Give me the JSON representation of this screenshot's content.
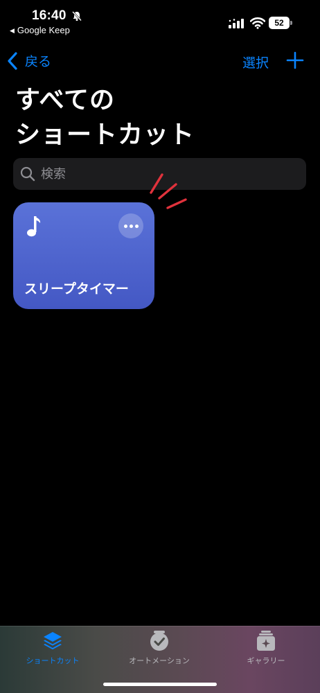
{
  "status_bar": {
    "time": "16:40",
    "back_app": "Google Keep",
    "battery": "52"
  },
  "nav": {
    "back_label": "戻る",
    "select_label": "選択"
  },
  "title": {
    "line1": "すべての",
    "line2": "ショートカット"
  },
  "search": {
    "placeholder": "検索"
  },
  "shortcuts": [
    {
      "label": "スリープタイマー",
      "icon": "music-note-icon",
      "color": "#4f66d0"
    }
  ],
  "tab_bar": {
    "tabs": [
      {
        "label": "ショートカット",
        "icon": "layers-icon",
        "active": true
      },
      {
        "label": "オートメーション",
        "icon": "clock-check-icon",
        "active": false
      },
      {
        "label": "ギャラリー",
        "icon": "gallery-sparkle-icon",
        "active": false
      }
    ]
  },
  "colors": {
    "accent": "#0a84ff",
    "card": "#4f66d0",
    "marks": "#e0323c"
  }
}
